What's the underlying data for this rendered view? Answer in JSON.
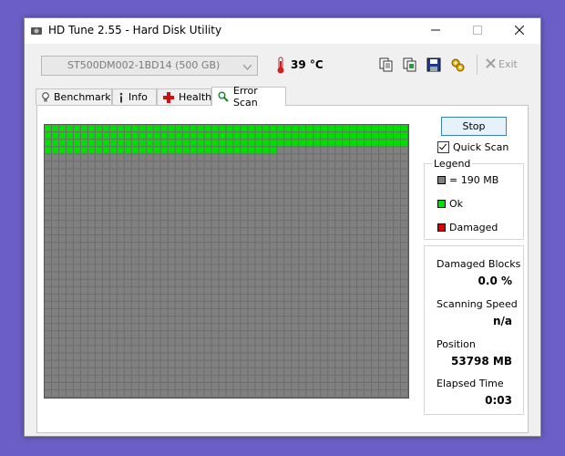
{
  "window": {
    "title": "HD Tune 2.55 - Hard Disk Utility"
  },
  "toolbar": {
    "drive": "ST500DM002-1BD14 (500 GB)",
    "temperature": "39 °C",
    "exit_label": "Exit",
    "icons": [
      "copy-text-icon",
      "copy-screenshot-icon",
      "save-icon",
      "options-icon"
    ]
  },
  "tabs": [
    {
      "label": "Benchmark",
      "icon": "lightbulb-icon"
    },
    {
      "label": "Info",
      "icon": "info-icon"
    },
    {
      "label": "Health",
      "icon": "health-cross-icon"
    },
    {
      "label": "Error Scan",
      "icon": "magnifier-icon",
      "active": true
    }
  ],
  "scan": {
    "stop_label": "Stop",
    "quick_scan_label": "Quick Scan",
    "quick_scan_checked": true,
    "grid": {
      "columns": 50,
      "rows": 37,
      "ok_full_rows": 3,
      "ok_cells_in_partial_row": 32
    }
  },
  "legend": {
    "title": "Legend",
    "items": [
      {
        "label": "= 190 MB",
        "color": "#808080"
      },
      {
        "label": "Ok",
        "color": "#00e000"
      },
      {
        "label": "Damaged",
        "color": "#e00000"
      }
    ]
  },
  "stats": {
    "damaged_blocks_label": "Damaged Blocks",
    "damaged_blocks_value": "0.0 %",
    "scanning_speed_label": "Scanning Speed",
    "scanning_speed_value": "n/a",
    "position_label": "Position",
    "position_value": "53798 MB",
    "elapsed_label": "Elapsed Time",
    "elapsed_value": "0:03"
  }
}
